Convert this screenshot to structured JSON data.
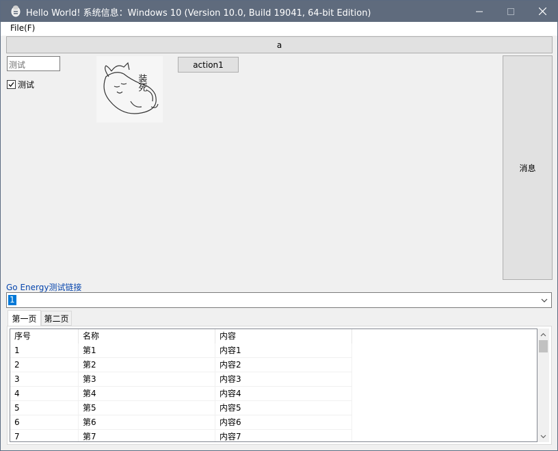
{
  "window": {
    "title": "Hello World! 系统信息：Windows 10 (Version 10.0, Build 19041, 64-bit Edition)",
    "minimize": "—",
    "maximize": "☐",
    "close": "✕"
  },
  "menu": {
    "file": "File(F)"
  },
  "top_button": "a",
  "text_input": {
    "value": "测试"
  },
  "checkbox": {
    "label": "测试",
    "checked": true
  },
  "image": {
    "caption_glyphs": "装死"
  },
  "action_button": "action1",
  "message_button": "消息",
  "link": "Go Energy测试链接",
  "combo": {
    "value": "1"
  },
  "tabs": [
    {
      "label": "第一页"
    },
    {
      "label": "第二页"
    }
  ],
  "table": {
    "headers": [
      "序号",
      "名称",
      "内容"
    ],
    "rows": [
      [
        "1",
        "第1",
        "内容1"
      ],
      [
        "2",
        "第2",
        "内容2"
      ],
      [
        "3",
        "第3",
        "内容3"
      ],
      [
        "4",
        "第4",
        "内容4"
      ],
      [
        "5",
        "第5",
        "内容5"
      ],
      [
        "6",
        "第6",
        "内容6"
      ],
      [
        "7",
        "第7",
        "内容7"
      ]
    ]
  },
  "colors": {
    "titlebar": "#5f6b7d",
    "link": "#0645ad",
    "selection": "#0078d7"
  }
}
